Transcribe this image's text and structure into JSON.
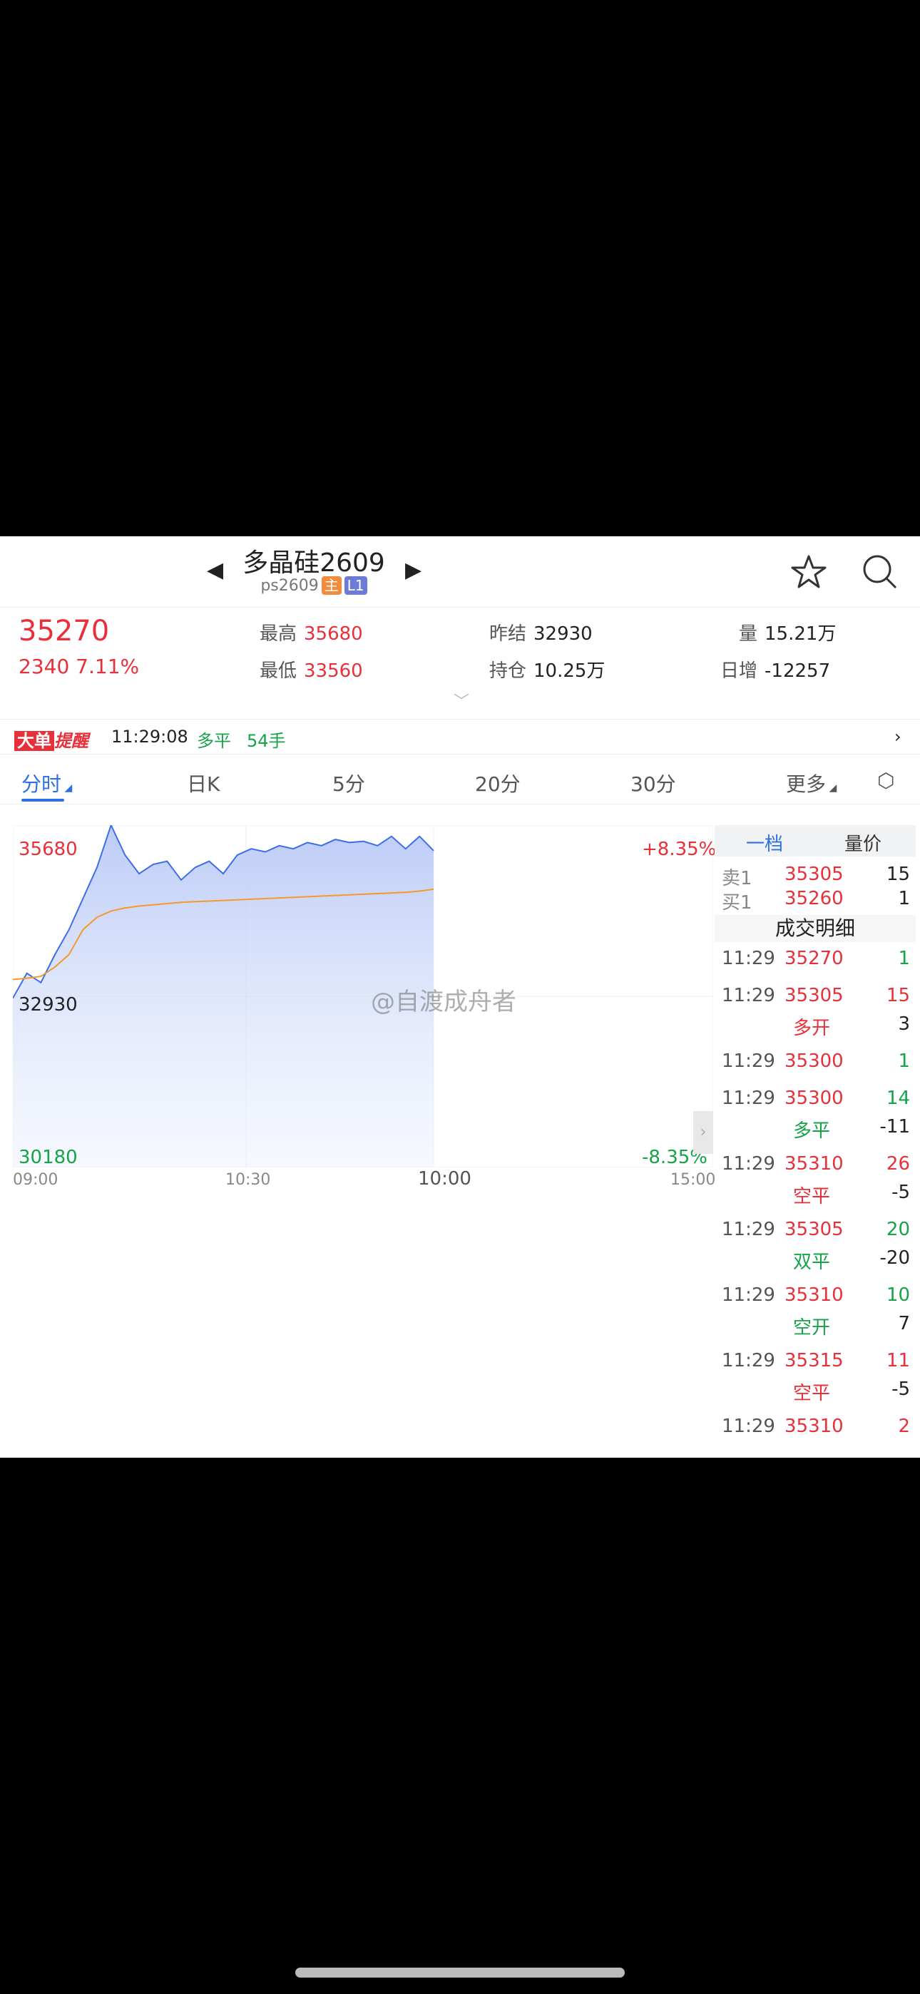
{
  "header": {
    "title": "多晶硅2609",
    "code": "ps2609",
    "tag_main": "主",
    "tag_level": "L1"
  },
  "quote": {
    "price": "35270",
    "change": "2340 7.11%",
    "high_label": "最高",
    "high": "35680",
    "low_label": "最低",
    "low": "33560",
    "prev_settle_label": "昨结",
    "prev_settle": "32930",
    "open_interest_label": "持仓",
    "open_interest": "10.25万",
    "volume_label": "量",
    "volume": "15.21万",
    "daily_inc_label": "日增",
    "daily_inc": "-12257"
  },
  "alert": {
    "badge_a": "大单",
    "badge_b": "提醒",
    "time": "11:29:08",
    "type": "多平",
    "size": "54手"
  },
  "tabs": [
    "分时",
    "日K",
    "5分",
    "20分",
    "30分",
    "更多"
  ],
  "chart": {
    "y_top": "35680",
    "y_mid": "32930",
    "y_bottom": "30180",
    "pct_top": "+8.35%",
    "pct_bottom": "-8.35%",
    "x_ticks": [
      "09:00",
      "10:30",
      "10:00",
      "15:00"
    ]
  },
  "chart_data": {
    "type": "line",
    "ylim": [
      30180,
      35680
    ],
    "series": [
      {
        "values": [
          32900,
          33300,
          33150,
          33600,
          34000,
          34500,
          35000,
          35680,
          35200,
          34900,
          35050,
          35100,
          34800,
          35000,
          35100,
          34900,
          35200,
          35300,
          35250,
          35350,
          35300,
          35400,
          35350,
          35450,
          35400,
          35420,
          35350,
          35500,
          35300,
          35500,
          35270
        ]
      },
      {
        "values": [
          33200,
          33220,
          33250,
          33400,
          33600,
          34000,
          34200,
          34300,
          34350,
          34380,
          34400,
          34420,
          34440,
          34450,
          34460,
          34470,
          34480,
          34490,
          34500,
          34510,
          34520,
          34530,
          34540,
          34550,
          34560,
          34570,
          34580,
          34590,
          34600,
          34620,
          34650
        ]
      }
    ],
    "colors": {
      "price": "#3d6ee6",
      "avg": "#f39a2b"
    }
  },
  "side": {
    "seg_a": "一档",
    "seg_b": "量价",
    "ask_label": "卖1",
    "ask_price": "35305",
    "ask_vol": "15",
    "bid_label": "买1",
    "bid_price": "35260",
    "bid_vol": "1",
    "section_title": "成交明细",
    "trades": [
      {
        "time": "11:29",
        "price": "35270",
        "vol": "1",
        "vol_color": "green"
      },
      {
        "time": "11:29",
        "price": "35305",
        "vol": "15",
        "vol_color": "red",
        "kind": "多开",
        "kind_color": "red",
        "diff": "3"
      },
      {
        "time": "11:29",
        "price": "35300",
        "vol": "1",
        "vol_color": "green"
      },
      {
        "time": "11:29",
        "price": "35300",
        "vol": "14",
        "vol_color": "green",
        "kind": "多平",
        "kind_color": "green",
        "diff": "-11"
      },
      {
        "time": "11:29",
        "price": "35310",
        "vol": "26",
        "vol_color": "red",
        "kind": "空平",
        "kind_color": "red",
        "diff": "-5"
      },
      {
        "time": "11:29",
        "price": "35305",
        "vol": "20",
        "vol_color": "green",
        "kind": "双平",
        "kind_color": "green",
        "diff": "-20"
      },
      {
        "time": "11:29",
        "price": "35310",
        "vol": "10",
        "vol_color": "green",
        "kind": "空开",
        "kind_color": "green",
        "diff": "7"
      },
      {
        "time": "11:29",
        "price": "35315",
        "vol": "11",
        "vol_color": "red",
        "kind": "空平",
        "kind_color": "red",
        "diff": "-5"
      },
      {
        "time": "11:29",
        "price": "35310",
        "vol": "2",
        "vol_color": "red"
      }
    ]
  },
  "watermark": "@自渡成舟者"
}
